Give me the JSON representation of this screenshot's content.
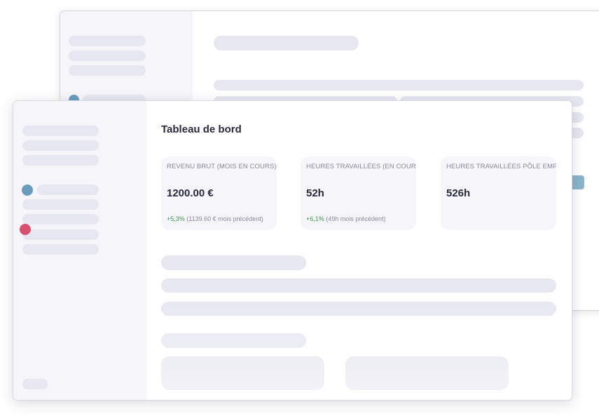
{
  "dashboard": {
    "title": "Tableau de bord",
    "cards": [
      {
        "label": "REVENU BRUT (MOIS EN COURS)",
        "value": "1200.00 €",
        "delta": "+5,3%",
        "previous": "(1139.60 € mois précédent)"
      },
      {
        "label": "HEURES TRAVAILLÉES (EN COURS)",
        "value": "52h",
        "delta": "+6,1%",
        "previous": "(49h mois précédent)"
      },
      {
        "label": "HEURES TRAVAILLÉES PÔLE EMPLOI",
        "value": "526h",
        "delta": "",
        "previous": ""
      }
    ]
  },
  "colors": {
    "accent_blue": "#6a9cbc",
    "accent_red": "#d7506f",
    "placeholder": "#e7e7f1",
    "sidebar_bg": "#f5f5fa",
    "trend_positive": "#3c9a4a"
  }
}
